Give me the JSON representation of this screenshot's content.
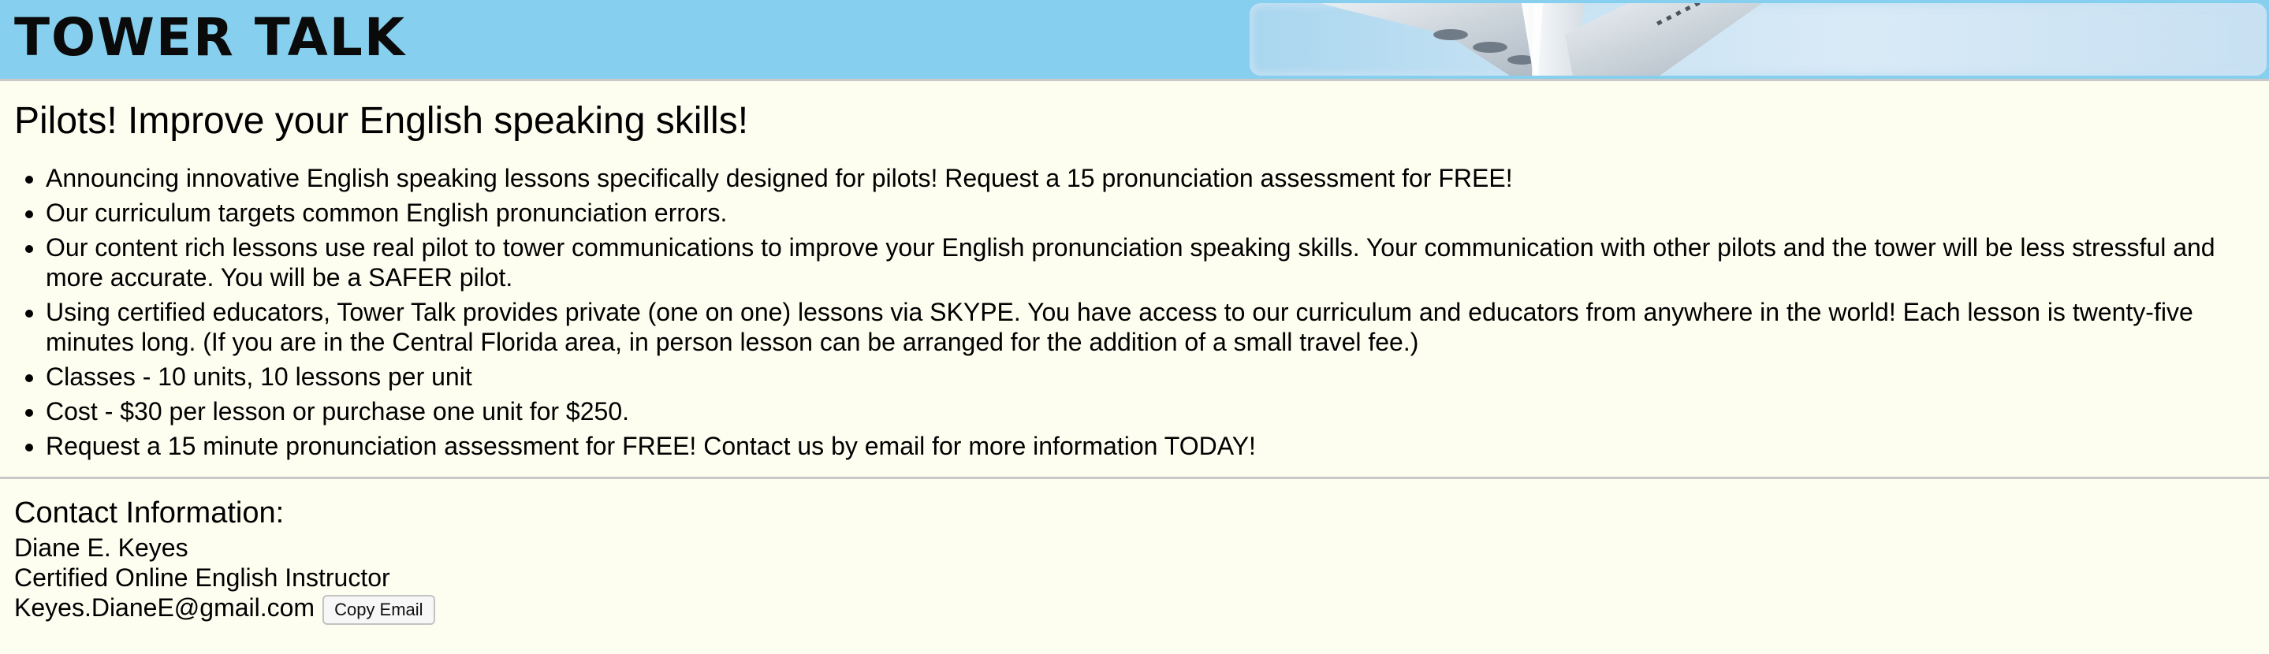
{
  "header": {
    "brand": "TOWER TALK",
    "banner_image": "airplane-wing-sky"
  },
  "main": {
    "title": "Pilots! Improve your English speaking skills!",
    "bullets": [
      "Announcing innovative English speaking lessons specifically designed for pilots! Request a 15 pronunciation assessment for FREE!",
      "Our curriculum targets common English pronunciation errors.",
      "Our content rich lessons use real pilot to tower communications to improve your English pronunciation speaking skills. Your communication with other pilots and the tower will be less stressful and more accurate. You will be a SAFER pilot.",
      "Using certified educators, Tower Talk provides private (one on one) lessons via SKYPE. You have access to our curriculum and educators from anywhere in the world! Each lesson is twenty-five minutes long. (If you are in the Central Florida area, in person lesson can be arranged for the addition of a small travel fee.)",
      "Classes - 10 units, 10 lessons per unit",
      "Cost - $30 per lesson or purchase one unit for $250.",
      "Request a 15 minute pronunciation assessment for FREE! Contact us by email for more information TODAY!"
    ]
  },
  "contact": {
    "heading": "Contact Information:",
    "name": "Diane E. Keyes",
    "role": "Certified Online English Instructor",
    "email": "Keyes.DianeE@gmail.com",
    "copy_button": "Copy Email"
  },
  "colors": {
    "header_bg": "#87cfee",
    "page_bg": "#fdfdf0",
    "divider": "#c9c9c9"
  }
}
